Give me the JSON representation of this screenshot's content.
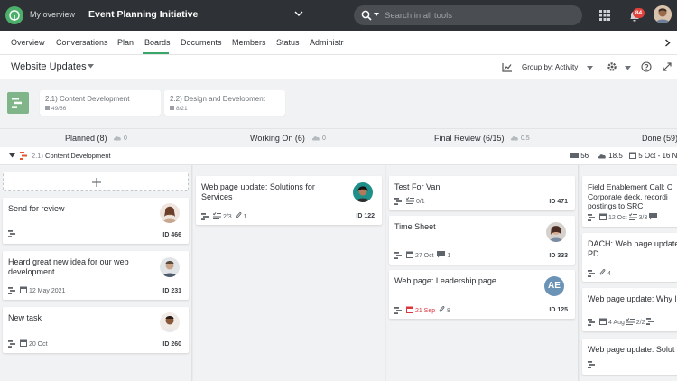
{
  "topbar": {
    "overview_label": "My overview",
    "project_title": "Event Planning Initiative",
    "search_placeholder": "Search in all tools",
    "notifications_count": "84"
  },
  "tabs": [
    "Overview",
    "Conversations",
    "Plan",
    "Boards",
    "Documents",
    "Members",
    "Status",
    "Administra"
  ],
  "active_tab": "Boards",
  "board": {
    "title": "Website Updates",
    "group_by_label": "Group by:",
    "group_by_value": "Activity"
  },
  "summary_cards": [
    {
      "number": "2.1)",
      "title": "Content Development",
      "progress": "49/56"
    },
    {
      "number": "2.2)",
      "title": "Design and Development",
      "progress": "8/21"
    }
  ],
  "columns": [
    {
      "name": "Planned",
      "count": "(8)",
      "meta": "0"
    },
    {
      "name": "Working On",
      "count": "(6)",
      "meta": "0"
    },
    {
      "name": "Final Review",
      "count": "(6/15)",
      "meta": "0.5"
    },
    {
      "name": "Done",
      "count": "(59)"
    }
  ],
  "lane": {
    "number": "2.1)",
    "title": "Content Development",
    "stats": {
      "count": "56",
      "effort": "18.5",
      "dates": "5 Oct - 16 N"
    }
  },
  "cards": {
    "planned": [
      {
        "title": "Send for review",
        "id": "ID 466"
      },
      {
        "title": "Heard great new idea for our web development",
        "date": "12 May 2021",
        "id": "ID 231"
      },
      {
        "title": "New task",
        "date": "20 Oct",
        "id": "ID 260"
      }
    ],
    "working": [
      {
        "title": "Web page update: Solutions for Services",
        "checklist": "2/3",
        "attachments": "1",
        "id": "ID 122"
      }
    ],
    "review": [
      {
        "title": "Test For Van",
        "checklist": "0/1",
        "id": "ID 471"
      },
      {
        "title": "Time Sheet",
        "date": "27 Oct",
        "comments": "1",
        "id": "ID 333"
      },
      {
        "title": "Web page: Leadership page",
        "date": "21 Sep",
        "attachments": "8",
        "id": "ID 125",
        "avatar_initials": "AE"
      }
    ],
    "done": [
      {
        "title": "Field Enablement Call: C Corporate deck, recordi postings to SRC",
        "date": "12 Oct",
        "checklist": "3/3"
      },
      {
        "title": "DACH: Web page update PD",
        "attachments": "4"
      },
      {
        "title": "Web page update: Why l",
        "date": "4 Aug",
        "checklist": "2/2"
      },
      {
        "title": "Web page update: Solut"
      }
    ]
  },
  "colors": {
    "accent": "#3aa66a",
    "topbar": "#2e3135",
    "overdue": "#d9363e"
  }
}
